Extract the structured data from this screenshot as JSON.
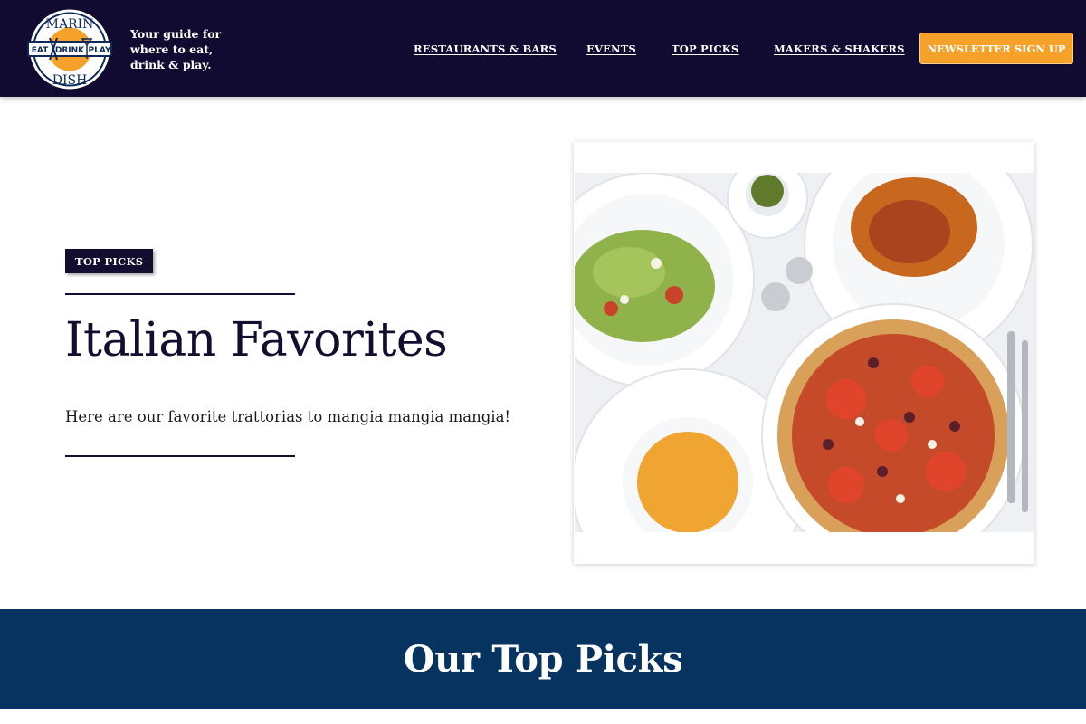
{
  "brand": {
    "logo_top": "MARIN",
    "logo_middle": [
      "EAT",
      "DRINK",
      "PLAY"
    ],
    "logo_bottom": "DISH",
    "tagline": "Your guide for where to eat, drink & play."
  },
  "nav": {
    "items": [
      {
        "label": "RESTAURANTS & BARS"
      },
      {
        "label": "EVENTS"
      },
      {
        "label": "TOP PICKS"
      },
      {
        "label": "MAKERS & SHAKERS"
      }
    ],
    "newsletter_label": "NEWSLETTER SIGN UP"
  },
  "hero": {
    "badge": "TOP PICKS",
    "title": "Italian Favorites",
    "description": "Here are our favorite trattorias to mangia mangia mangia!"
  },
  "section": {
    "title": "Our Top Picks"
  },
  "colors": {
    "header_bg": "#120b31",
    "accent_orange": "#f6a22a",
    "band_bg": "#063360",
    "text_dark": "#130d2f"
  }
}
